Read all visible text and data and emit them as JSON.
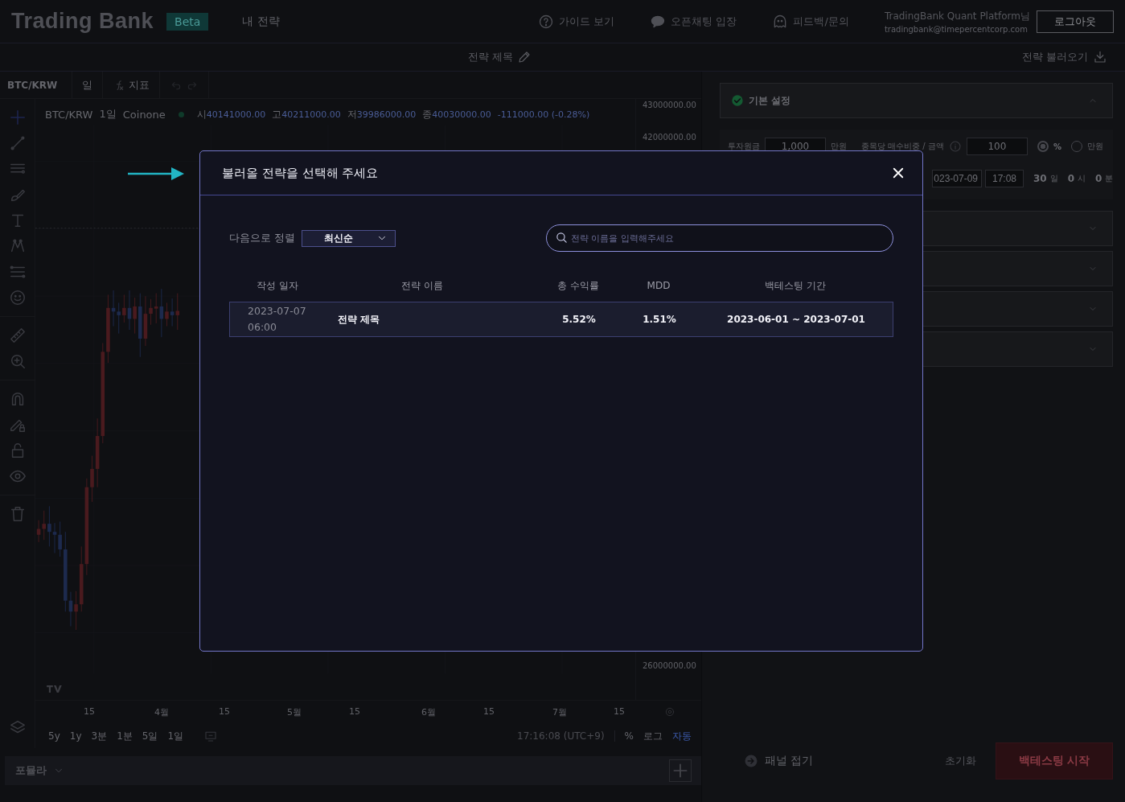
{
  "header": {
    "logo": "Trading Bank",
    "badge": "Beta",
    "nav": [
      {
        "label": "내 전략"
      }
    ],
    "links": [
      {
        "kind": "help",
        "label": "가이드 보기"
      },
      {
        "kind": "talk",
        "label": "오픈채팅 입장"
      },
      {
        "kind": "feedback",
        "label": "피드백/문의"
      }
    ],
    "user": {
      "name": "TradingBank Quant Platform님",
      "email": "tradingbank@timepercentcorp.com"
    },
    "logout": "로그아웃"
  },
  "subheader": {
    "title": "전략 제목",
    "load": "전략 불러오기"
  },
  "chart": {
    "toolbar": {
      "symbol": "BTC/KRW",
      "interval": "일",
      "indicators": "지표"
    },
    "legend": {
      "symbol": "BTC/KRW",
      "interval": "1일",
      "exchange": "Coinone",
      "ohlc": [
        {
          "label": "시",
          "value": "40141000.00"
        },
        {
          "label": "고",
          "value": "40211000.00"
        },
        {
          "label": "저",
          "value": "39986000.00"
        },
        {
          "label": "종",
          "value": "40030000.00"
        }
      ],
      "change": "-111000.00 (-0.28%)"
    },
    "y_axis": [
      "43000000.00",
      "42000000.00",
      "26000000.00"
    ],
    "x_axis": [
      "15",
      "4월",
      "15",
      "5월",
      "15",
      "6월",
      "15",
      "7월",
      "15"
    ],
    "ranges": [
      "5y",
      "1y",
      "3분",
      "1분",
      "5일",
      "1일"
    ],
    "time": "17:16:08 (UTC+9)",
    "scale_options": [
      {
        "label": "%",
        "selected": false
      },
      {
        "label": "로그",
        "selected": false
      },
      {
        "label": "자동",
        "selected": true
      }
    ]
  },
  "formula_bar": {
    "label": "포뮬라"
  },
  "panel": {
    "sections": [
      {
        "title": "기본 설정",
        "done": true,
        "expanded": true
      },
      {
        "expanded": false
      },
      {
        "expanded": false
      },
      {
        "expanded": false
      },
      {
        "expanded": false
      }
    ],
    "settings": {
      "principal_label": "투자원금",
      "principal": "1,000",
      "principal_unit": "만원",
      "weight_label": "종목당 매수비중 / 금액",
      "weight": "100",
      "weight_units": [
        {
          "label": "%",
          "selected": true
        },
        {
          "label": "만원",
          "selected": false
        }
      ],
      "end_date": "023-07-09",
      "end_time": "17:08",
      "duration": [
        {
          "value": "30",
          "unit": "일"
        },
        {
          "value": "0",
          "unit": "시"
        },
        {
          "value": "0",
          "unit": "분"
        }
      ]
    },
    "footer": {
      "collapse": "패널 접기",
      "reset": "초기화",
      "start": "백테스팅 시작"
    }
  },
  "modal": {
    "title": "불러올 전략을 선택해 주세요",
    "sort_label": "다음으로 정렬",
    "sort_value": "최신순",
    "search": {
      "placeholder": "전략 이름을 입력해주세요"
    },
    "columns": [
      "작성 일자",
      "전략 이름",
      "총 수익률",
      "MDD",
      "백테스팅 기간"
    ],
    "rows": [
      {
        "created": "2023-07-07 06:00",
        "name": "전략 제목",
        "return": "5.52%",
        "mdd": "1.51%",
        "period": "2023-06-01 ~ 2023-07-01",
        "selected": true
      }
    ]
  }
}
